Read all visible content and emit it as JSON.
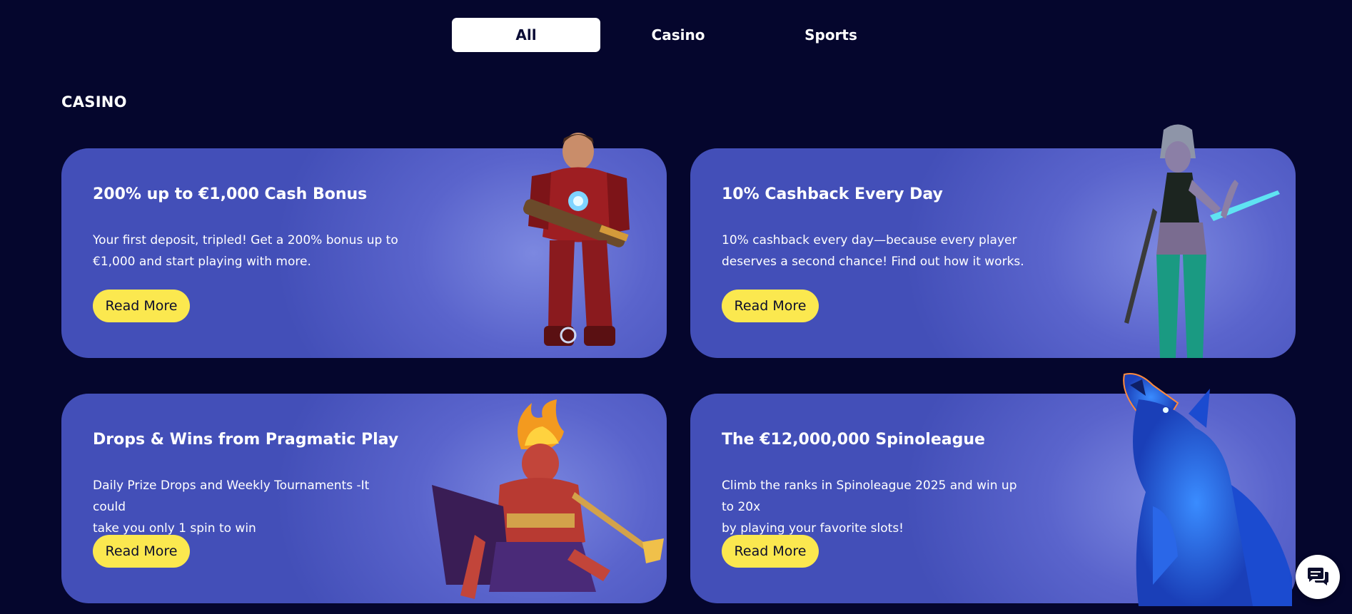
{
  "tabs": {
    "all": "All",
    "casino": "Casino",
    "sports": "Sports",
    "active": "All"
  },
  "section": {
    "title": "CASINO"
  },
  "cards": [
    {
      "title": "200% up to €1,000 Cash Bonus",
      "desc_line1": "Your first deposit, tripled! Get a 200% bonus up to",
      "desc_line2": "€1,000 and start playing with more.",
      "button": "Read More",
      "art_icon": "armored-soldier-character-icon"
    },
    {
      "title": "10% Cashback Every Day",
      "desc_line1": "10% cashback every day—because every player",
      "desc_line2": "deserves a second chance! Find out how it works.",
      "button": "Read More",
      "art_icon": "warrior-woman-character-icon"
    },
    {
      "title": "Drops & Wins from Pragmatic Play",
      "desc_line1": "Daily Prize Drops and Weekly Tournaments -It could",
      "desc_line2": "take you only 1 spin to win",
      "button": "Read More",
      "art_icon": "fire-demon-character-icon"
    },
    {
      "title": "The €12,000,000 Spinoleague",
      "desc_line1": "Climb the ranks in Spinoleague 2025 and win up to 20x",
      "desc_line2": "by playing your favorite slots!",
      "button": "Read More",
      "art_icon": "howling-wolf-character-icon"
    }
  ],
  "chat": {
    "icon": "chat-bubbles-icon"
  },
  "colors": {
    "page_bg": "#05062d",
    "card_bg": "#434fb8",
    "button_bg": "#fbe84f",
    "tab_active_bg": "#ffffff"
  }
}
